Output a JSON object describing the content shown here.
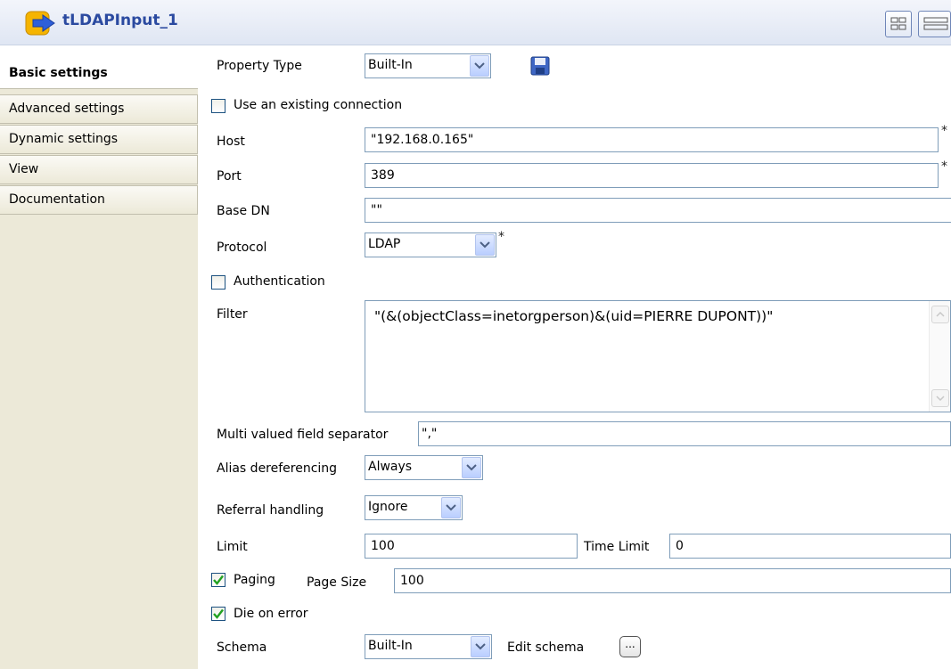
{
  "header": {
    "title": "tLDAPInput_1"
  },
  "tabs": [
    {
      "label": "Basic settings"
    },
    {
      "label": "Advanced settings"
    },
    {
      "label": "Dynamic settings"
    },
    {
      "label": "View"
    },
    {
      "label": "Documentation"
    }
  ],
  "form": {
    "property_type": {
      "label": "Property Type",
      "value": "Built-In"
    },
    "use_existing_connection": {
      "label": "Use an existing connection",
      "checked": false
    },
    "host": {
      "label": "Host",
      "value": "\"192.168.0.165\"",
      "required_mark": "*"
    },
    "port": {
      "label": "Port",
      "value": "389",
      "required_mark": "*"
    },
    "base_dn": {
      "label": "Base DN",
      "value": "\"\""
    },
    "protocol": {
      "label": "Protocol",
      "value": "LDAP",
      "required_mark": "*"
    },
    "authentication": {
      "label": "Authentication",
      "checked": false
    },
    "filter": {
      "label": "Filter",
      "value": "\"(&(objectClass=inetorgperson)&(uid=PIERRE DUPONT))\""
    },
    "multi_valued_separator": {
      "label": "Multi valued field separator",
      "value": "\",\""
    },
    "alias_dereferencing": {
      "label": "Alias dereferencing",
      "value": "Always"
    },
    "referral_handling": {
      "label": "Referral handling",
      "value": "Ignore"
    },
    "limit": {
      "label": "Limit",
      "value": "100"
    },
    "time_limit": {
      "label": "Time Limit",
      "value": "0"
    },
    "paging": {
      "label": "Paging",
      "checked": true
    },
    "page_size": {
      "label": "Page Size",
      "value": "100"
    },
    "die_on_error": {
      "label": "Die on error",
      "checked": true
    },
    "schema": {
      "label": "Schema",
      "value": "Built-In"
    },
    "edit_schema": {
      "label": "Edit schema",
      "button": "..."
    }
  },
  "icons": {
    "component": "ldap-component-icon",
    "save": "save-icon",
    "dropdown": "chevron-down-icon",
    "check": "checkmark-icon"
  },
  "colors": {
    "title": "#2b4aa0",
    "checkmark": "#21a121",
    "field_border": "#7f9db9"
  }
}
